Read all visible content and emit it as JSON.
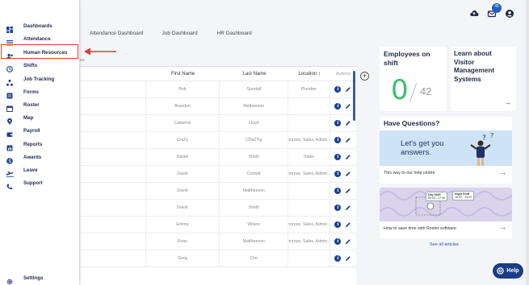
{
  "tabs": [
    "Attendance Dashboard",
    "Job Dashboard",
    "HR Dashboard"
  ],
  "sub_tab": "es",
  "table": {
    "headers": [
      "First Name",
      "Last Name",
      "Location",
      "Actions"
    ],
    "location_sort_icon": "↕",
    "rows": [
      [
        "Bob",
        "Goodall",
        "Plumber"
      ],
      [
        "Brandon",
        "Matheeson",
        ""
      ],
      [
        "Cameron",
        "Lloyd",
        ""
      ],
      [
        "CraZy",
        "CRaZYg",
        "Builder, Pennrose, Sales, Admin... Finance..."
      ],
      [
        "Daniel",
        "Smith",
        "Sales"
      ],
      [
        "David",
        "Corbett",
        "Builder, Pennrose, Sales, Admin... Finance..."
      ],
      [
        "David",
        "Mattheeson",
        ""
      ],
      [
        "David",
        "Smith",
        ""
      ],
      [
        "Emma",
        "Wilson",
        "Builder, Pennrose, Sales, Admin... Finance..."
      ],
      [
        "Evan",
        "Mattheeson",
        "Builder, Pennrose, Sales, Admin... Finance..."
      ],
      [
        "Greg",
        "Cho",
        ""
      ]
    ]
  },
  "employees_card": {
    "title": "Employees on shift",
    "count": "0",
    "total": "42"
  },
  "learn_card": {
    "title": "Learn about Visitor Management Systems"
  },
  "questions_card": {
    "title": "Have Questions?",
    "banner_text": "Let's get you answers.",
    "desc": "This way to our help centre"
  },
  "save_card": {
    "desc": "How to save time with Roster software",
    "mini1_title": "Day Shift",
    "mini1_time": "08:00 - 17:00",
    "mini2_title": "Night Shift",
    "mini2_time": "18:00 - 23:00"
  },
  "see_all": "See all articles",
  "help_label": "Help",
  "notification_count": "45",
  "sidebar": {
    "items": [
      {
        "label": "Dashboards",
        "icon": "dashboard-icon"
      },
      {
        "label": "Attendance",
        "icon": "list-icon"
      },
      {
        "label": "Human Resources",
        "icon": "people-icon"
      },
      {
        "label": "Shifts",
        "icon": "clock-icon"
      },
      {
        "label": "Job Tracking",
        "icon": "nodes-icon"
      },
      {
        "label": "Forms",
        "icon": "form-icon"
      },
      {
        "label": "Roster",
        "icon": "calendar-icon"
      },
      {
        "label": "Map",
        "icon": "map-pin-icon"
      },
      {
        "label": "Payroll",
        "icon": "wallet-icon"
      },
      {
        "label": "Reports",
        "icon": "report-icon"
      },
      {
        "label": "Awards",
        "icon": "dollar-icon"
      },
      {
        "label": "Leave",
        "icon": "plane-icon"
      },
      {
        "label": "Support",
        "icon": "phone-icon"
      }
    ],
    "settings": "Settings"
  },
  "colors": {
    "accent": "#1c3d86",
    "highlight": "#e33a32",
    "green": "#3cc06a"
  }
}
